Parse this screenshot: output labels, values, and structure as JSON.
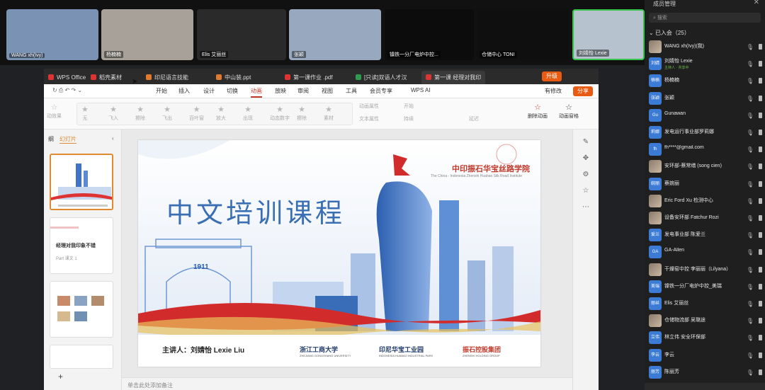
{
  "video_tiles": [
    {
      "name": "WANG xh(Ivy)",
      "bg": "#7a93b5"
    },
    {
      "name": "杨楠楠",
      "bg": "#a8a19a"
    },
    {
      "name": "Elis 艾丽丝",
      "bg": "#2a2a2a"
    },
    {
      "name": "张颖",
      "bg": "#98a9bf"
    },
    {
      "name": "镇铁一分厂电炉中控...",
      "bg": "#0c0c0c"
    },
    {
      "name": "仓储中心 TONI",
      "bg": "#0f0f0f"
    },
    {
      "name": "刘婧怡 Lexie",
      "bg": "#b7c2cf"
    }
  ],
  "app": {
    "tabs": [
      {
        "label": "WPS Office",
        "color": "#d33"
      },
      {
        "label": "稻壳素材",
        "color": "#d33"
      },
      {
        "label": "印尼语言技能",
        "color": "#e07b2d"
      },
      {
        "label": "中山装.ppt",
        "color": "#e07b2d"
      },
      {
        "label": "第一课作业 .pdf",
        "color": "#d33"
      },
      {
        "label": "[只读]双语人才汉",
        "color": "#2e9b4f"
      },
      {
        "label": "第一课 经理对我印",
        "color": "#d33"
      }
    ],
    "upgrade_label": "升级",
    "menu": [
      "开始",
      "插入",
      "设计",
      "切换",
      "动画",
      "放映",
      "审阅",
      "视图",
      "工具",
      "会员专享",
      "WPS AI"
    ],
    "active_menu": "动画",
    "edit_label": "有修改",
    "share_label": "分享",
    "ribbon_effects": [
      "无",
      "飞入",
      "擦除",
      "飞出",
      "百叶窗",
      "放大",
      "出现",
      "动态数字",
      "擦除",
      "素材"
    ],
    "ribbon_left": "动效果",
    "ribbon_props": [
      "动画属性",
      "文本属性",
      "开始",
      "持续",
      "延迟"
    ],
    "ribbon_right": [
      "删除动画",
      "动画窗格"
    ],
    "panel_tabs": [
      "纲",
      "幻灯片"
    ],
    "thumb2_title": "经理对我印象不错",
    "thumb2_sub": "Part 课文 1",
    "notes_placeholder": "单击此处添加备注"
  },
  "slide": {
    "title": "中文培训课程",
    "lecturer": "主讲人：刘婧怡 Lexie Liu",
    "school_cn": "中印振石华宝丝路学院",
    "school_en": "The China - Indonesia Zhenshi Huabao Silk Road Institute",
    "arch_year": "1911",
    "logos": [
      {
        "cn": "浙江工商大学",
        "en": "ZHEJIANG GONGSHANG UNIVERSITY",
        "color": "#1f3a6b"
      },
      {
        "cn": "印尼华宝工业园",
        "en": "INDONESIA HUABAO INDUSTRIAL PARK",
        "color": "#1f3a6b"
      },
      {
        "cn": "振石控股集团",
        "en": "ZHENSHI HOLDING GROUP",
        "color": "#1f3a6b"
      }
    ]
  },
  "panel": {
    "header": "成员管理",
    "search_placeholder": "搜索",
    "group_label": "已入会（25）",
    "members": [
      {
        "name": "WANG xh(Ivy)(我)",
        "avatar": "photo",
        "tag": ""
      },
      {
        "name": "刘婧怡 Lexie",
        "avatar": "刘婧",
        "tag": "主持人 · 共享中"
      },
      {
        "name": "杨楠楠",
        "avatar": "楠楠",
        "tag": ""
      },
      {
        "name": "张颖",
        "avatar": "张颖",
        "tag": ""
      },
      {
        "name": "Gunawan",
        "avatar": "Gu",
        "tag": ""
      },
      {
        "name": "发电运行事业部罗莉娜",
        "avatar": "莉娜",
        "tag": ""
      },
      {
        "name": "fh****@gmail.com",
        "avatar": "fh",
        "tag": ""
      },
      {
        "name": "安环部-蔡常缮 (song cien)",
        "avatar": "photo",
        "tag": ""
      },
      {
        "name": "蔡婉丽",
        "avatar": "婉丽",
        "tag": ""
      },
      {
        "name": "Eric Ford Xu 检测中心",
        "avatar": "photo",
        "tag": ""
      },
      {
        "name": "设备安环部 Fatchur Rozi",
        "avatar": "photo",
        "tag": ""
      },
      {
        "name": "发电事业部 陈爱兰",
        "avatar": "爱兰",
        "tag": ""
      },
      {
        "name": "GA-Allen",
        "avatar": "GA",
        "tag": ""
      },
      {
        "name": "干燥窑中控 李丽丽（Lilyana）",
        "avatar": "photo",
        "tag": ""
      },
      {
        "name": "镍铁一分厂电炉中控_美瑞",
        "avatar": "美瑞",
        "tag": ""
      },
      {
        "name": "Elis 艾丽丝",
        "avatar": "丽丝",
        "tag": ""
      },
      {
        "name": "仓储物流部 吴璐途",
        "avatar": "photo",
        "tag": ""
      },
      {
        "name": "林立伟 安全环保部",
        "avatar": "立伟",
        "tag": ""
      },
      {
        "name": "李云",
        "avatar": "李云",
        "tag": ""
      },
      {
        "name": "陈丽芳",
        "avatar": "丽芳",
        "tag": ""
      }
    ]
  }
}
